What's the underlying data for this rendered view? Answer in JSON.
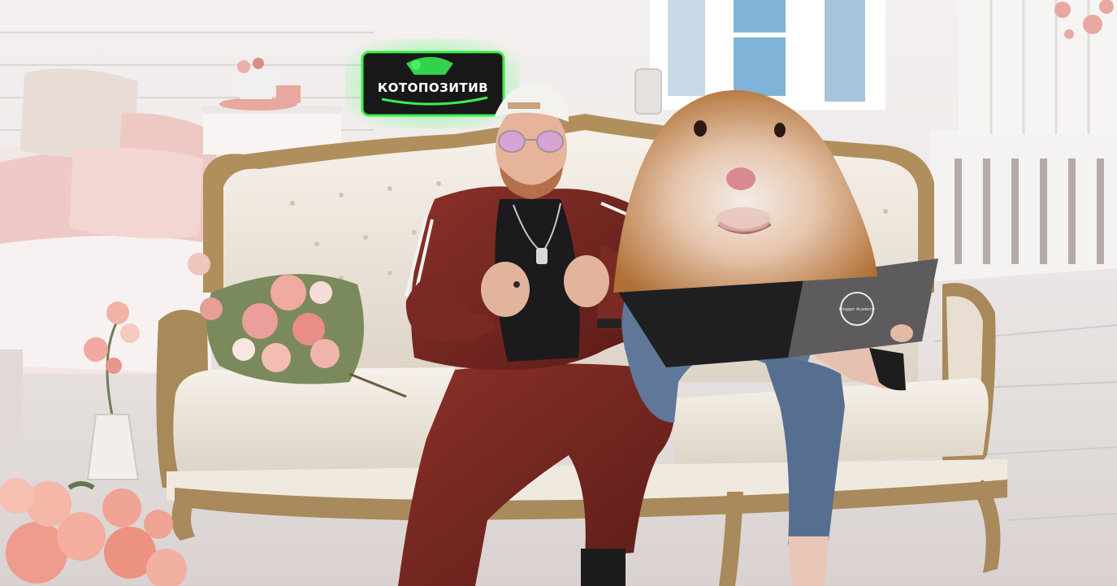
{
  "scene": {
    "tv_sign_text": "КОТОПОЗИТИВ",
    "laptop_logo_text": "Blogger Academy"
  },
  "colors": {
    "wall": "#ece7e6",
    "floor": "#e4dedd",
    "sofa_frame": "#a88a5c",
    "sofa_cushion": "#efe7dc",
    "tracksuit": "#7a2a24",
    "jeans": "#5d7494",
    "hamster": "#c98d4f",
    "roses": "#f0a49a",
    "sign_green": "#35e84a"
  }
}
